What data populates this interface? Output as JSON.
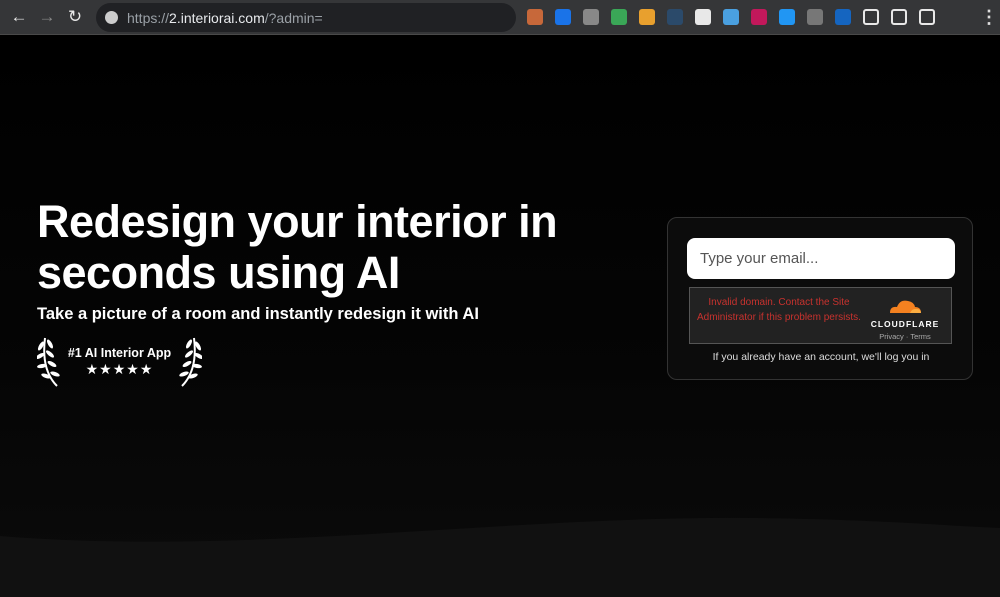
{
  "browser": {
    "url_prefix": "https://",
    "url_host": "2.interiorai.com",
    "url_path": "/?admin=",
    "extensions": [
      {
        "name": "cookie-icon",
        "color": "#c7683a"
      },
      {
        "name": "1password-icon",
        "color": "#1a73e8"
      },
      {
        "name": "ublock-icon",
        "color": "#888888"
      },
      {
        "name": "toggle-extension-icon",
        "color": "#3aa757"
      },
      {
        "name": "css-pencil-icon",
        "color": "#e8a02e"
      },
      {
        "name": "pen-icon",
        "color": "#2b4a6a"
      },
      {
        "name": "picture-in-picture-icon",
        "color": "#e8e8e8"
      },
      {
        "name": "screenshot-icon",
        "color": "#4aa0e0"
      },
      {
        "name": "play-icon",
        "color": "#c2185b"
      },
      {
        "name": "bird-icon",
        "color": "#2196f3"
      },
      {
        "name": "w-icon",
        "color": "#777777"
      },
      {
        "name": "checkmark-icon",
        "color": "#1565c0"
      },
      {
        "name": "puzzle-icon",
        "color": "#e8e8e8"
      },
      {
        "name": "media-queue-icon",
        "color": "#e8e8e8"
      },
      {
        "name": "side-panel-icon",
        "color": "#e8e8e8"
      }
    ]
  },
  "hero": {
    "title": "Redesign your interior in seconds using AI",
    "subtitle": "Take a picture of a room and instantly redesign it with AI",
    "badge": "#1 AI Interior App",
    "stars": "★★★★★"
  },
  "signup": {
    "email_placeholder": "Type your email...",
    "captcha_error": "Invalid domain. Contact the Site Administrator if this problem persists.",
    "captcha_brand": "CLOUDFLARE",
    "privacy": "Privacy",
    "separator": "·",
    "terms": "Terms",
    "login_note": "If you already have an account, we'll log you in"
  }
}
